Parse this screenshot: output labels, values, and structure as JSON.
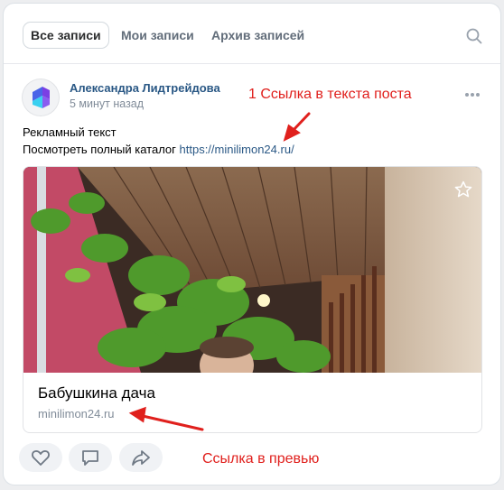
{
  "tabs": [
    {
      "label": "Все записи",
      "active": true
    },
    {
      "label": "Мои записи",
      "active": false
    },
    {
      "label": "Архив записей",
      "active": false
    }
  ],
  "post": {
    "author": "Александра Лидтрейдова",
    "time": "5 минут назад",
    "text_line1": "Рекламный текст",
    "text_line2_prefix": "Посмотреть полный каталог ",
    "text_link": "https://minilimon24.ru/",
    "preview": {
      "title": "Бабушкина дача",
      "domain": "minilimon24.ru"
    }
  },
  "annotations": {
    "top": "1 Ссылка в текста поста",
    "bottom": "Ссылка в превью"
  },
  "colors": {
    "accent_link": "#2a5885",
    "annotation_red": "#e0201d",
    "muted": "#818c99"
  },
  "icons": [
    "search-icon",
    "more-icon",
    "star-icon",
    "like-icon",
    "comment-icon",
    "share-icon"
  ]
}
